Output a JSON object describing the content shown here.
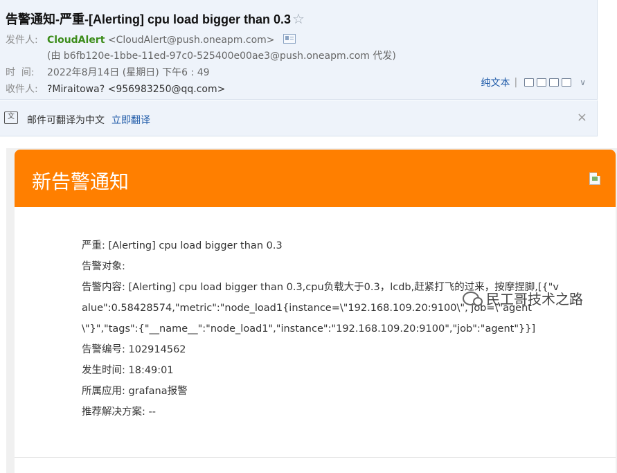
{
  "header": {
    "subject": "告警通知-严重-[Alerting] cpu load bigger than 0.3",
    "star": "☆",
    "from_label": "发件人:",
    "sender_name": "CloudAlert",
    "sender_addr": "<CloudAlert@push.oneapm.com>",
    "on_behalf": "(由 b6fb120e-1bbe-11ed-97c0-525400e00ae3@push.oneapm.com 代发)",
    "time_label": "时  间:",
    "time_value": "2022年8月14日 (星期日) 下午6 : 49",
    "to_label": "收件人:",
    "to_value": "?Miraitowa? <956983250@qq.com>",
    "plain_text_label": "纯文本",
    "separator": "|"
  },
  "translate_bar": {
    "text": "邮件可翻译为中文",
    "link": "立即翻译",
    "close": "×"
  },
  "mail": {
    "banner_title": "新告警通知",
    "accent": "#ff7f00",
    "lines": {
      "severity": "严重: [Alerting] cpu load bigger than 0.3",
      "target": "告警对象:",
      "content": "告警内容: [Alerting] cpu load bigger than 0.3,cpu负载大于0.3，lcdb,赶紧打飞的过来，按摩捏脚,[{\"value\":0.58428574,\"metric\":\"node_load1{instance=\\\"192.168.109.20:9100\\\", job=\\\"agent\\\"}\",\"tags\":{\"__name__\":\"node_load1\",\"instance\":\"192.168.109.20:9100\",\"job\":\"agent\"}}]",
      "alert_id": "告警编号: 102914562",
      "occur_time": "发生时间: 18:49:01",
      "app": "所属应用: grafana报警",
      "solution": "推荐解决方案: --"
    }
  },
  "watermark": {
    "text": "民工哥技术之路"
  }
}
